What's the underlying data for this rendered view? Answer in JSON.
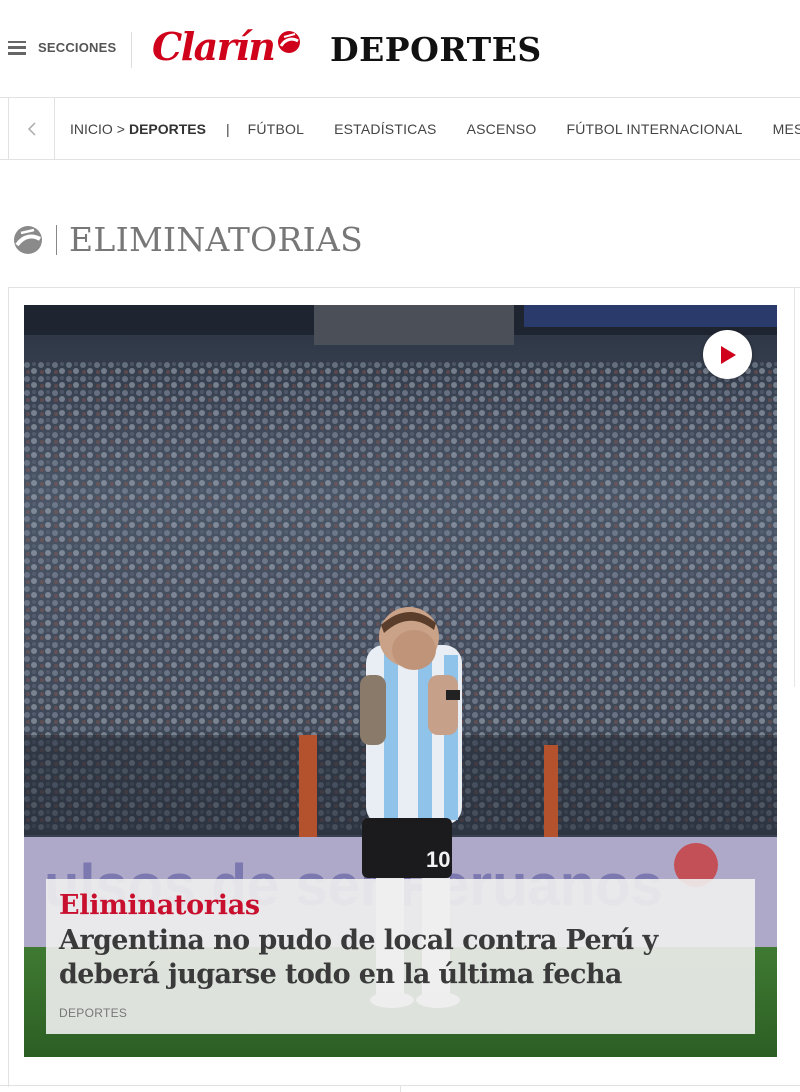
{
  "header": {
    "menu_label": "SECCIONES",
    "logo_text": "Clarín",
    "section_name": "DEPORTES",
    "brand_color": "#d0021b"
  },
  "nav": {
    "breadcrumb": {
      "home": "INICIO",
      "separator": ">",
      "current": "DEPORTES"
    },
    "divider": "|",
    "links": [
      "FÚTBOL",
      "ESTADÍSTICAS",
      "ASCENSO",
      "FÚTBOL INTERNACIONAL",
      "MESS"
    ]
  },
  "section": {
    "title": "ELIMINATORIAS"
  },
  "featured": {
    "kicker": "Eliminatorias",
    "headline": "Argentina no pudo de local contra Perú y deberá jugarse todo en la última fecha",
    "category": "DEPORTES",
    "has_video": true,
    "kicker_color": "#c8102e"
  },
  "icons": {
    "menu": "hamburger-icon",
    "back": "chevron-left-icon",
    "section": "clarin-logo-icon",
    "play": "play-icon"
  }
}
